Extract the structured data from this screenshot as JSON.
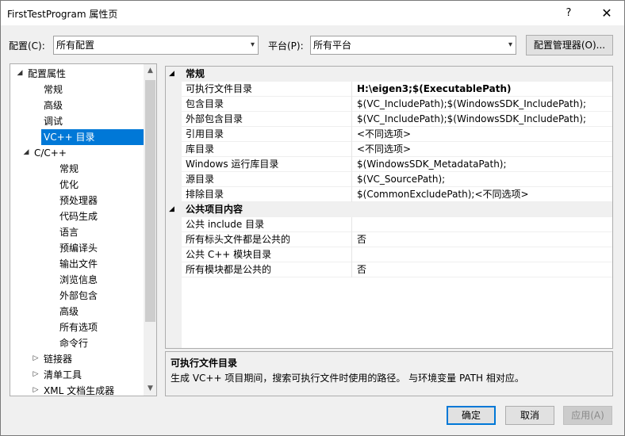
{
  "window": {
    "title": "FirstTestProgram 属性页",
    "help_label": "?",
    "close_label": "✕"
  },
  "config": {
    "config_label": "配置(C):",
    "config_value": "所有配置",
    "platform_label": "平台(P):",
    "platform_value": "所有平台",
    "manager_label": "配置管理器(O)..."
  },
  "tree": {
    "items": [
      {
        "label": "配置属性",
        "expander": "◢"
      },
      {
        "label": "常规"
      },
      {
        "label": "高级"
      },
      {
        "label": "调试"
      },
      {
        "label": "VC++ 目录",
        "selected": true
      },
      {
        "label": "C/C++",
        "expander": "◢"
      },
      {
        "label": "常规"
      },
      {
        "label": "优化"
      },
      {
        "label": "预处理器"
      },
      {
        "label": "代码生成"
      },
      {
        "label": "语言"
      },
      {
        "label": "预编译头"
      },
      {
        "label": "输出文件"
      },
      {
        "label": "浏览信息"
      },
      {
        "label": "外部包含"
      },
      {
        "label": "高级"
      },
      {
        "label": "所有选项"
      },
      {
        "label": "命令行"
      },
      {
        "label": "链接器",
        "expander": "▷"
      },
      {
        "label": "清单工具",
        "expander": "▷"
      },
      {
        "label": "XML 文档生成器",
        "expander": "▷"
      }
    ]
  },
  "grid": {
    "categories": [
      {
        "label": "常规"
      },
      {
        "label": "公共项目内容"
      }
    ],
    "general_rows": [
      {
        "name": "可执行文件目录",
        "value": "H:\\eigen3;$(ExecutablePath)",
        "bold": true
      },
      {
        "name": "包含目录",
        "value": "$(VC_IncludePath);$(WindowsSDK_IncludePath);"
      },
      {
        "name": "外部包含目录",
        "value": "$(VC_IncludePath);$(WindowsSDK_IncludePath);"
      },
      {
        "name": "引用目录",
        "value": "<不同选项>"
      },
      {
        "name": "库目录",
        "value": "<不同选项>"
      },
      {
        "name": "Windows 运行库目录",
        "value": "$(WindowsSDK_MetadataPath);"
      },
      {
        "name": "源目录",
        "value": "$(VC_SourcePath);"
      },
      {
        "name": "排除目录",
        "value": "$(CommonExcludePath);<不同选项>"
      }
    ],
    "public_rows": [
      {
        "name": "公共 include 目录",
        "value": ""
      },
      {
        "name": "所有标头文件都是公共的",
        "value": "否"
      },
      {
        "name": "公共 C++ 模块目录",
        "value": ""
      },
      {
        "name": "所有模块都是公共的",
        "value": "否"
      }
    ]
  },
  "description": {
    "title": "可执行文件目录",
    "text": "生成 VC++ 项目期间，搜索可执行文件时使用的路径。 与环境变量 PATH 相对应。"
  },
  "buttons": {
    "ok": "确定",
    "cancel": "取消",
    "apply": "应用(A)"
  }
}
